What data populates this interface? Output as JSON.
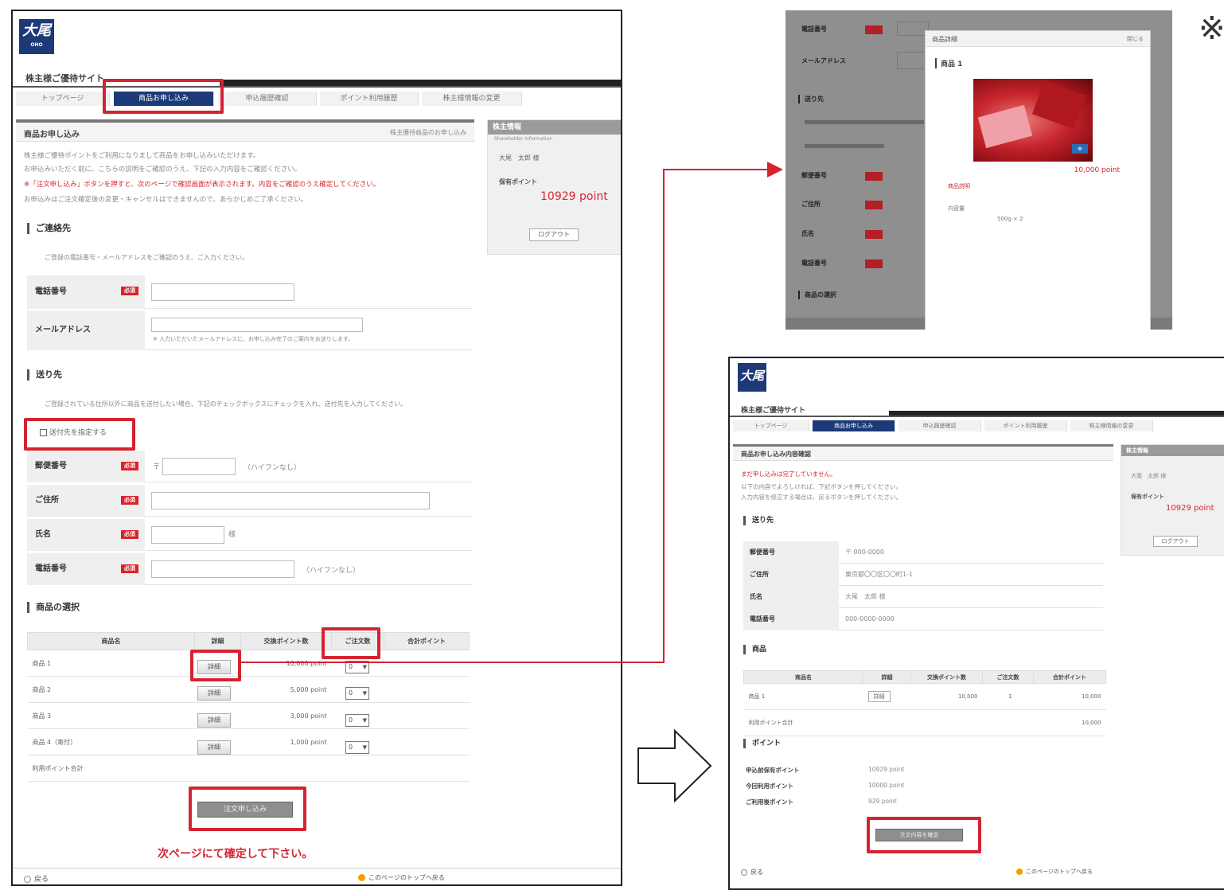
{
  "main": {
    "logo_text": "大尾",
    "logo_sub": "OHO",
    "site_title": "株主様ご優待サイト",
    "tabs": [
      "トップページ",
      "商品お申し込み",
      "申込履歴確認",
      "ポイント利用履歴",
      "株主様情報の変更"
    ],
    "form_title": "商品お申し込み",
    "form_title_right": "株主優待商品のお申し込み",
    "intro_lines": [
      "株主様ご優待ポイントをご利用になりまして商品をお申し込みいただけます。",
      "お申込みいただく前に、こちらの説明をご確認のうえ、下記の入力内容をご確認ください。",
      "※「注文申し込み」ボタンを押すと、次のページで確認画面が表示されます。内容をご確認のうえ確定してください。",
      "お申込みはご注文確定後の変更・キャンセルはできませんので、あらかじめご了承ください。"
    ],
    "section_customer": "ご連絡先",
    "customer_note": "ご登録の電話番号・メールアドレスをご確認のうえ、ご入力ください。",
    "field_phone": "電話番号",
    "field_email": "メールアドレス",
    "email_note": "※ 入力いただいたメールアドレスに、お申し込み完了のご案内をお送りします。",
    "section_delivery": "送り先",
    "delivery_note": "ご登録されている住所以外に商品を送付したい場合、下記のチェックボックスにチェックを入れ、送付先を入力してください。",
    "checkbox_label": "送付先を指定する",
    "field_zip": "郵便番号",
    "zip_prefix": "〒",
    "zip_note": "（ハイフンなし）",
    "field_address": "ご住所",
    "field_name": "氏名",
    "name_suffix": "様",
    "field_tel": "電話番号",
    "tel_note": "（ハイフンなし）",
    "required_badge": "必須",
    "section_products": "商品の選択",
    "table_headers": [
      "商品名",
      "詳細",
      "交換ポイント数",
      "ご注文数",
      "合計ポイント"
    ],
    "products": [
      {
        "name": "商品 1",
        "detail": "詳細",
        "points": "10,000 point",
        "qty": "0"
      },
      {
        "name": "商品 2",
        "detail": "詳細",
        "points": "5,000 point",
        "qty": "0"
      },
      {
        "name": "商品 3",
        "detail": "詳細",
        "points": "3,000 point",
        "qty": "0"
      },
      {
        "name": "商品 4（寄付）",
        "detail": "詳細",
        "points": "1,000 point",
        "qty": "0"
      }
    ],
    "total_label": "利用ポイント合計",
    "submit_label": "注文申し込み",
    "next_page_note": "次ページにて確定して下さい。",
    "back_label": "戻る",
    "top_link": "このページのトップへ戻る"
  },
  "side_panel": {
    "title": "株主情報",
    "subtitle": "Shareholder Information",
    "name_line": "大尾　太郎 様",
    "points_label": "保有ポイント",
    "points_value": "10929 point",
    "logout": "ログアウト"
  },
  "modal": {
    "bg_labels": [
      "電話番号",
      "メールアドレス",
      "送り先",
      "郵便番号",
      "ご住所",
      "氏名",
      "電話番号",
      "商品の選択"
    ],
    "popup_title": "商品詳細",
    "popup_close": "閉じる",
    "product_name": "商品 1",
    "price": "10,000 point",
    "desc_label": "商品説明",
    "spec_label": "内容量",
    "spec_value": "500g × 2"
  },
  "confirm": {
    "logo_text": "大尾",
    "site_title": "株主様ご優待サイト",
    "tabs": [
      "トップページ",
      "商品お申し込み",
      "申込履歴確認",
      "ポイント利用履歴",
      "株主様情報の変更"
    ],
    "page_title": "商品お申し込み内容確認",
    "warn_line": "まだ申し込みは完了していません。",
    "note_lines": [
      "以下の内容でよろしければ、下記ボタンを押してください。",
      "入力内容を修正する場合は、戻るボタンを押してください。"
    ],
    "section_delivery": "送り先",
    "delivery_rows": [
      {
        "label": "郵便番号",
        "value": "〒 000-0000"
      },
      {
        "label": "ご住所",
        "value": "東京都〇〇区〇〇町1-1"
      },
      {
        "label": "氏名",
        "value": "大尾　太郎 様"
      },
      {
        "label": "電話番号",
        "value": "000-0000-0000"
      }
    ],
    "section_items": "商品",
    "item_headers": [
      "商品名",
      "詳細",
      "交換ポイント数",
      "ご注文数",
      "合計ポイント"
    ],
    "item_rows": [
      {
        "name": "商品 1",
        "detail": "詳細",
        "points": "10,000",
        "qty": "1",
        "total": "10,000"
      },
      {
        "name": "利用ポイント合計",
        "detail": "",
        "points": "",
        "qty": "",
        "total": "10,000"
      }
    ],
    "section_points": "ポイント",
    "point_rows": [
      {
        "label": "申込前保有ポイント",
        "value": "10929 point"
      },
      {
        "label": "今回利用ポイント",
        "value": "10000 point"
      },
      {
        "label": "ご利用後ポイント",
        "value": "929 point"
      }
    ],
    "confirm_button": "注文内容を確定",
    "back_label": "戻る",
    "top_link": "このページのトップへ戻る",
    "side_title": "株主情報",
    "side_name": "大尾　太郎 様",
    "side_points_label": "保有ポイント",
    "side_points_value": "10929 point",
    "side_logout": "ログアウト"
  },
  "note_mark": "※",
  "colors": {
    "highlight": "#d42331",
    "navy": "#1d3a78",
    "required": "#d9242c"
  }
}
